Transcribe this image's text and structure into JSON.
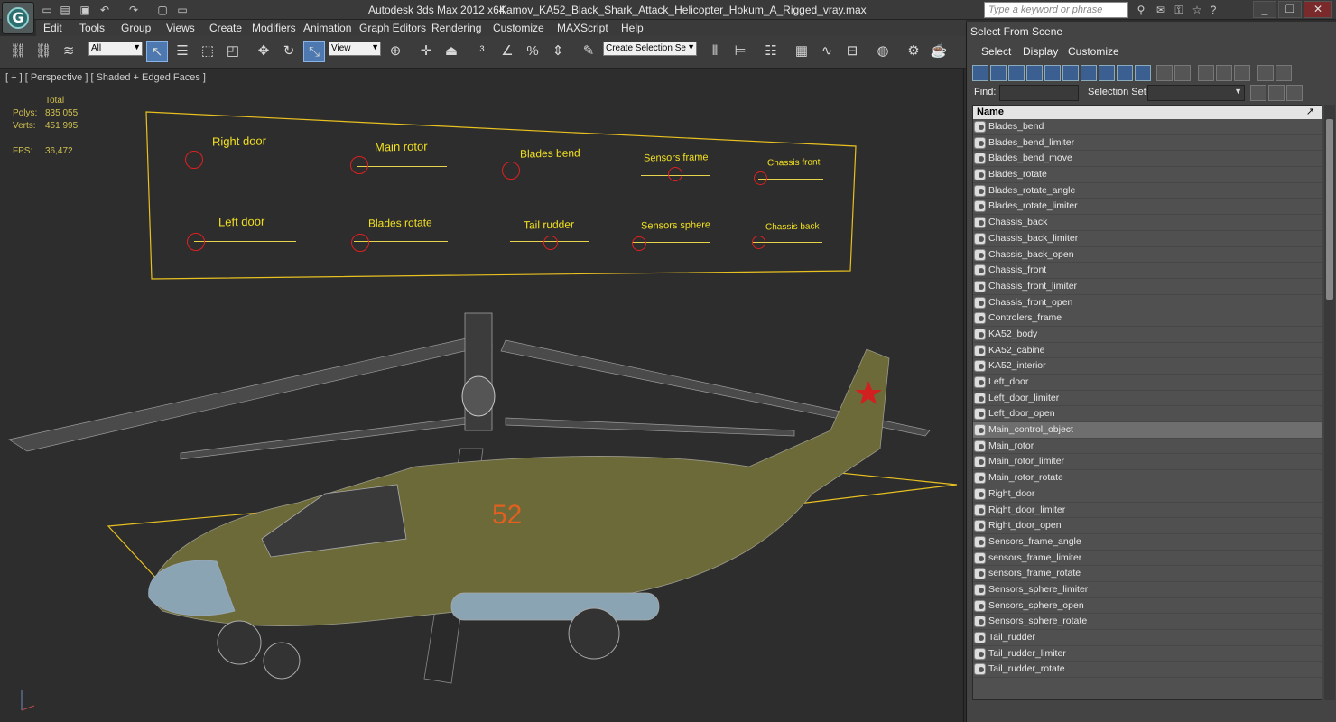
{
  "app": {
    "title": "Autodesk 3ds Max  2012 x64",
    "file": "Kamov_KA52_Black_Shark_Attack_Helicopter_Hokum_A_Rigged_vray.max",
    "search_placeholder": "Type a keyword or phrase"
  },
  "menu": [
    "Edit",
    "Tools",
    "Group",
    "Views",
    "Create",
    "Modifiers",
    "Animation",
    "Graph Editors",
    "Rendering",
    "Customize",
    "MAXScript",
    "Help"
  ],
  "toolbar": {
    "filter_value": "All",
    "refcoord_value": "View",
    "selection_set_value": "Create Selection Se"
  },
  "viewport": {
    "label": "[ + ] [ Perspective ] [ Shaded + Edged Faces ]",
    "stats": {
      "total_label": "Total",
      "polys_label": "Polys:",
      "polys_value": "835 055",
      "verts_label": "Verts:",
      "verts_value": "451 995",
      "fps_label": "FPS:",
      "fps_value": "36,472"
    },
    "controls": [
      "Right door",
      "Main rotor",
      "Blades bend",
      "Sensors frame",
      "Chassis front",
      "Left door",
      "Blades rotate",
      "Tail rudder",
      "Sensors sphere",
      "Chassis back"
    ],
    "hull_number": "52"
  },
  "scene_panel": {
    "title": "Select From Scene",
    "menu": [
      "Select",
      "Display",
      "Customize"
    ],
    "find_label": "Find:",
    "selection_set_label": "Selection Set:",
    "column_name": "Name",
    "items": [
      "Blades_bend",
      "Blades_bend_limiter",
      "Blades_bend_move",
      "Blades_rotate",
      "Blades_rotate_angle",
      "Blades_rotate_limiter",
      "Chassis_back",
      "Chassis_back_limiter",
      "Chassis_back_open",
      "Chassis_front",
      "Chassis_front_limiter",
      "Chassis_front_open",
      "Controlers_frame",
      "KA52_body",
      "KA52_cabine",
      "KA52_interior",
      "Left_door",
      "Left_door_limiter",
      "Left_door_open",
      "Main_control_object",
      "Main_rotor",
      "Main_rotor_limiter",
      "Main_rotor_rotate",
      "Right_door",
      "Right_door_limiter",
      "Right_door_open",
      "Sensors_frame_angle",
      "sensors_frame_limiter",
      "sensors_frame_rotate",
      "Sensors_sphere_limiter",
      "Sensors_sphere_open",
      "Sensors_sphere_rotate",
      "Tail_rudder",
      "Tail_rudder_limiter",
      "Tail_rudder_rotate"
    ],
    "selected_item": "Main_control_object"
  },
  "colors": {
    "control_text": "#f2e020",
    "control_circle": "#e02020",
    "selection_box": "#e8c020",
    "wire": "#9a9a9a",
    "body": "#6d6a3a"
  }
}
